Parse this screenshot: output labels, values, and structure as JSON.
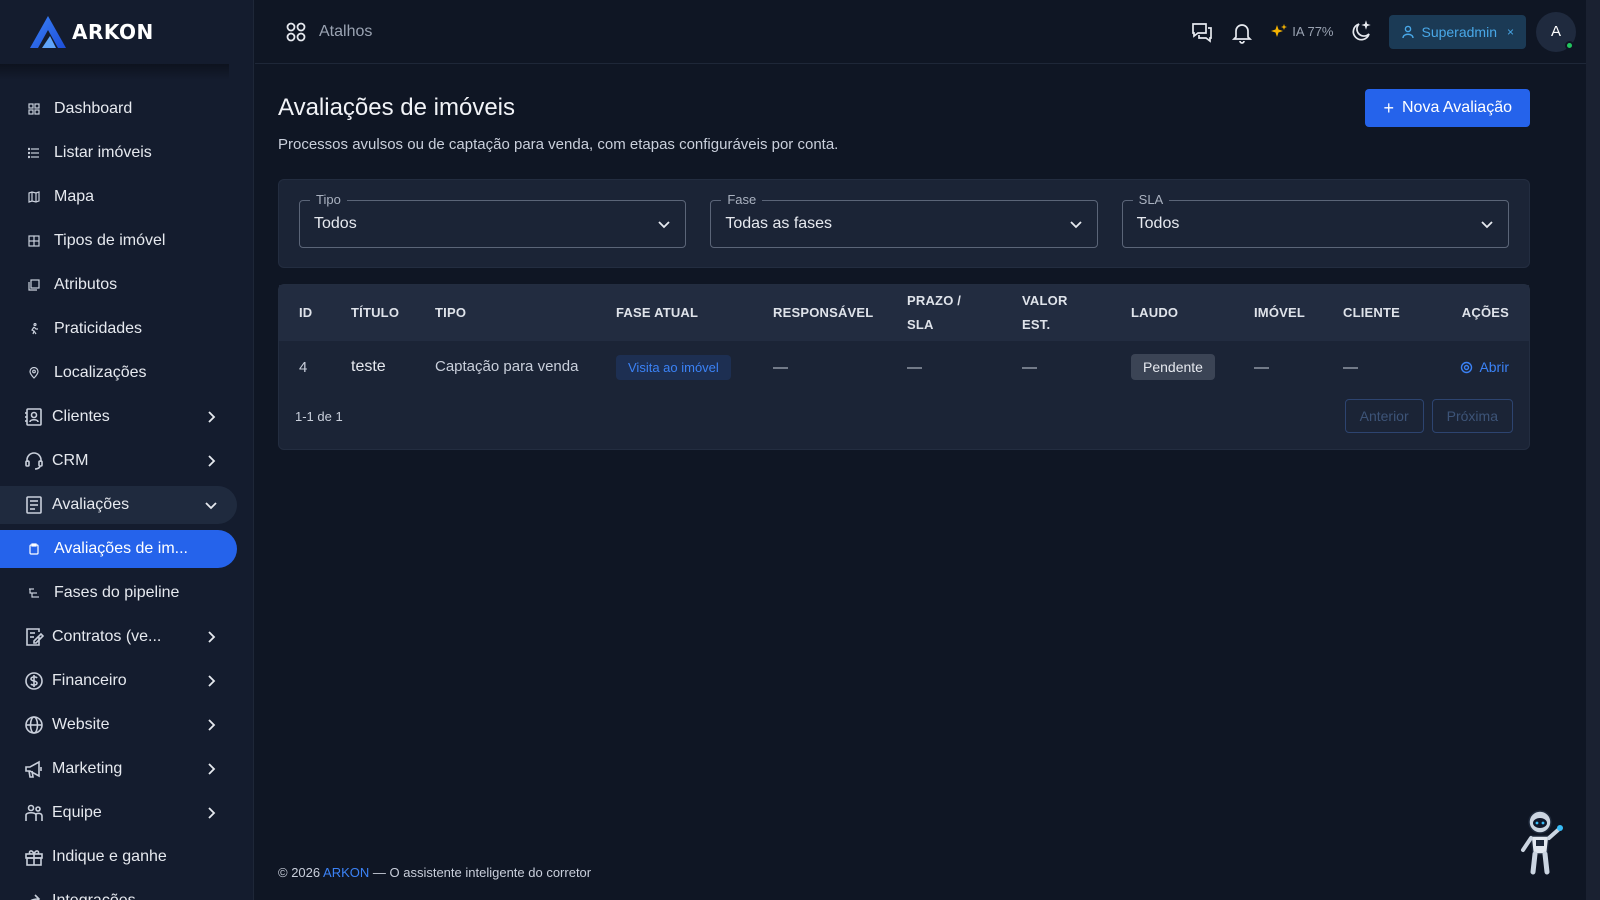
{
  "brand": {
    "name": "ARKON"
  },
  "sidebar": {
    "items": [
      {
        "label": "Dashboard",
        "icon": "dashboard-icon",
        "chevron": ""
      },
      {
        "label": "Listar imóveis",
        "icon": "list-icon",
        "chevron": ""
      },
      {
        "label": "Mapa",
        "icon": "map-icon",
        "chevron": ""
      },
      {
        "label": "Tipos de imóvel",
        "icon": "grid-icon",
        "chevron": ""
      },
      {
        "label": "Atributos",
        "icon": "attributes-icon",
        "chevron": ""
      },
      {
        "label": "Praticidades",
        "icon": "walk-icon",
        "chevron": ""
      },
      {
        "label": "Localizações",
        "icon": "location-icon",
        "chevron": ""
      },
      {
        "label": "Clientes",
        "icon": "contacts-icon",
        "chevron": "right"
      },
      {
        "label": "CRM",
        "icon": "headset-icon",
        "chevron": "right"
      },
      {
        "label": "Avaliações",
        "icon": "report-icon",
        "chevron": "down"
      },
      {
        "label": "Avaliações de im...",
        "icon": "clipboard-icon",
        "chevron": ""
      },
      {
        "label": "Fases do pipeline",
        "icon": "pipeline-icon",
        "chevron": ""
      },
      {
        "label": "Contratos (ve...",
        "icon": "contract-icon",
        "chevron": "right"
      },
      {
        "label": "Financeiro",
        "icon": "dollar-icon",
        "chevron": "right"
      },
      {
        "label": "Website",
        "icon": "globe-icon",
        "chevron": "right"
      },
      {
        "label": "Marketing",
        "icon": "megaphone-icon",
        "chevron": "right"
      },
      {
        "label": "Equipe",
        "icon": "team-icon",
        "chevron": "right"
      },
      {
        "label": "Indique e ganhe",
        "icon": "gift-icon",
        "chevron": ""
      },
      {
        "label": "Integrações",
        "icon": "share-icon",
        "chevron": ""
      }
    ]
  },
  "topbar": {
    "shortcuts_label": "Atalhos",
    "ia_label": "IA 77%",
    "role_label": "Superadmin",
    "role_close": "×",
    "avatar_initial": "A"
  },
  "main": {
    "title": "Avaliações de imóveis",
    "subtitle": "Processos avulsos ou de captação para venda, com etapas configuráveis por conta.",
    "new_button": "Nova Avaliação",
    "new_button_plus": "+"
  },
  "filters": {
    "tipo": {
      "label": "Tipo",
      "value": "Todos"
    },
    "fase": {
      "label": "Fase",
      "value": "Todas as fases"
    },
    "sla": {
      "label": "SLA",
      "value": "Todos"
    }
  },
  "table": {
    "headers": {
      "id": "ID",
      "titulo": "TÍTULO",
      "tipo": "TIPO",
      "fase": "FASE ATUAL",
      "responsavel": "RESPONSÁVEL",
      "prazo_1": "PRAZO /",
      "prazo_2": "SLA",
      "valor_1": "VALOR",
      "valor_2": "EST.",
      "laudo": "LAUDO",
      "imovel": "IMÓVEL",
      "cliente": "CLIENTE",
      "acoes": "AÇÕES"
    },
    "rows": [
      {
        "id": "4",
        "titulo": "teste",
        "tipo": "Captação para venda",
        "fase": "Visita ao imóvel",
        "responsavel": "—",
        "prazo": "—",
        "valor": "—",
        "laudo": "Pendente",
        "imovel": "—",
        "cliente": "—",
        "acao": "Abrir"
      }
    ],
    "count": "1-1 de 1",
    "prev": "Anterior",
    "next": "Próxima"
  },
  "footer": {
    "copyright": "© 2026",
    "brand": "ARKON",
    "tagline": "— O assistente inteligente do corretor"
  },
  "colors": {
    "accent": "#2563eb",
    "background": "#0f1624",
    "sidebar": "#141c2e",
    "card": "#1b2436",
    "link": "#3b82f6"
  }
}
